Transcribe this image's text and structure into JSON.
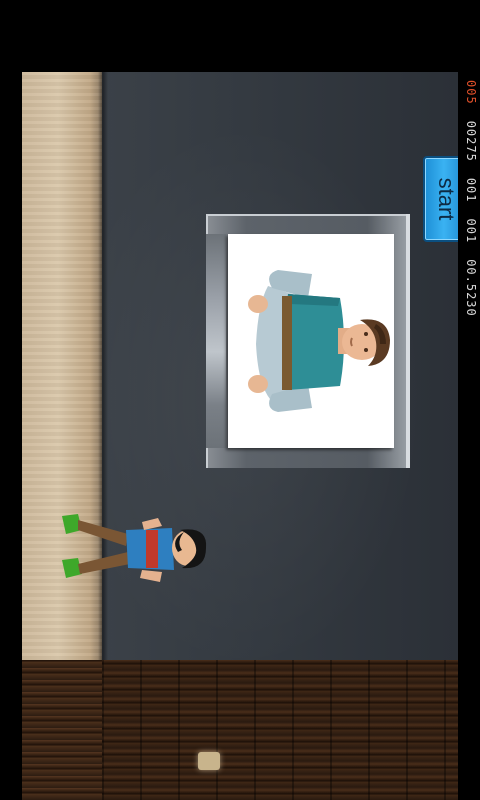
{
  "game": {
    "start_label": "start"
  },
  "hud": {
    "level": "005",
    "score": "00275",
    "value_a": "001",
    "value_b": "001",
    "time": "00.5230"
  },
  "colors": {
    "level_text": "#e0502a",
    "hud_text": "#d8d8d8",
    "start_button": "#2aa3e6",
    "wall": "#343a41",
    "floor": "#d4c1a2",
    "wood_floor": "#3f2716"
  },
  "scene": {
    "picture_subject": "portrait-of-young-man",
    "player_character": "boy-with-dark-hair"
  }
}
